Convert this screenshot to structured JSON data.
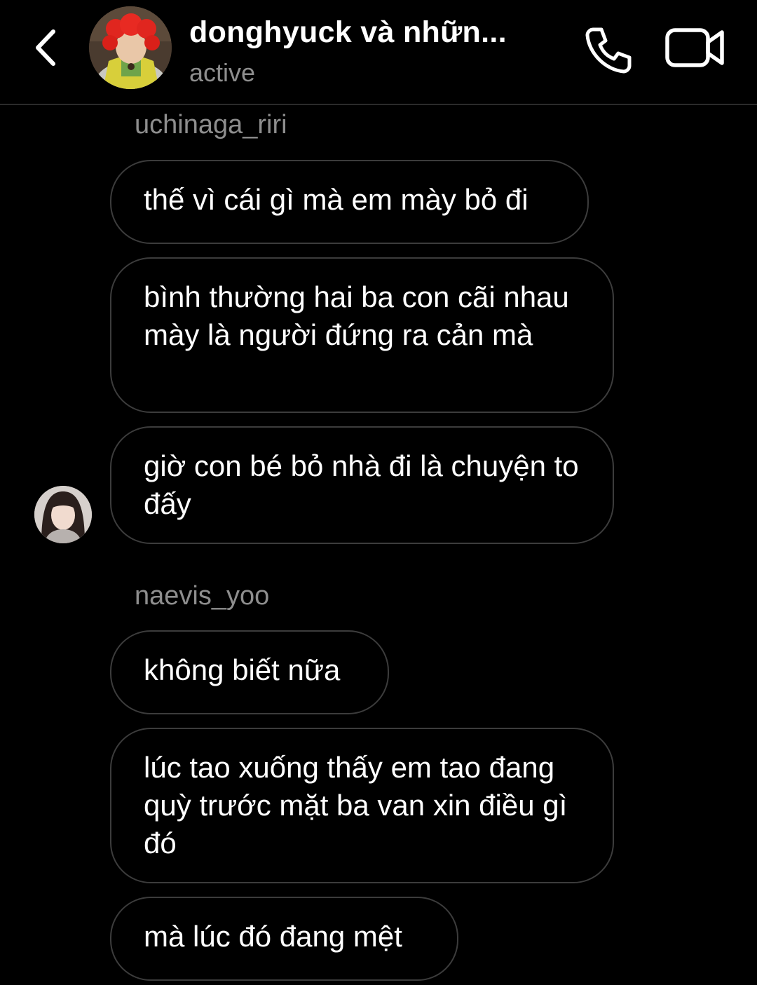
{
  "header": {
    "title": "donghyuck và nhữn...",
    "status": "active",
    "back_icon": "chevron-left-icon",
    "call_icon": "phone-icon",
    "video_icon": "video-camera-icon"
  },
  "thread": {
    "groups": [
      {
        "sender": "uchinaga_riri",
        "messages": [
          "thế vì cái gì mà em mày bỏ đi",
          "bình thường hai ba con cãi nhau mày là người đứng ra cản mà",
          "giờ con bé bỏ nhà đi là chuyện to đấy"
        ]
      },
      {
        "sender": "naevis_yoo",
        "messages": [
          "không biết nữa",
          "lúc tao xuống thấy em tao đang quỳ trước mặt ba van xin điều gì đó",
          "mà lúc đó đang mệt"
        ]
      }
    ]
  },
  "colors": {
    "background": "#000000",
    "bubble_border": "#3c3c3c",
    "muted_text": "#8e8e8e",
    "divider": "#2b2b2b"
  }
}
